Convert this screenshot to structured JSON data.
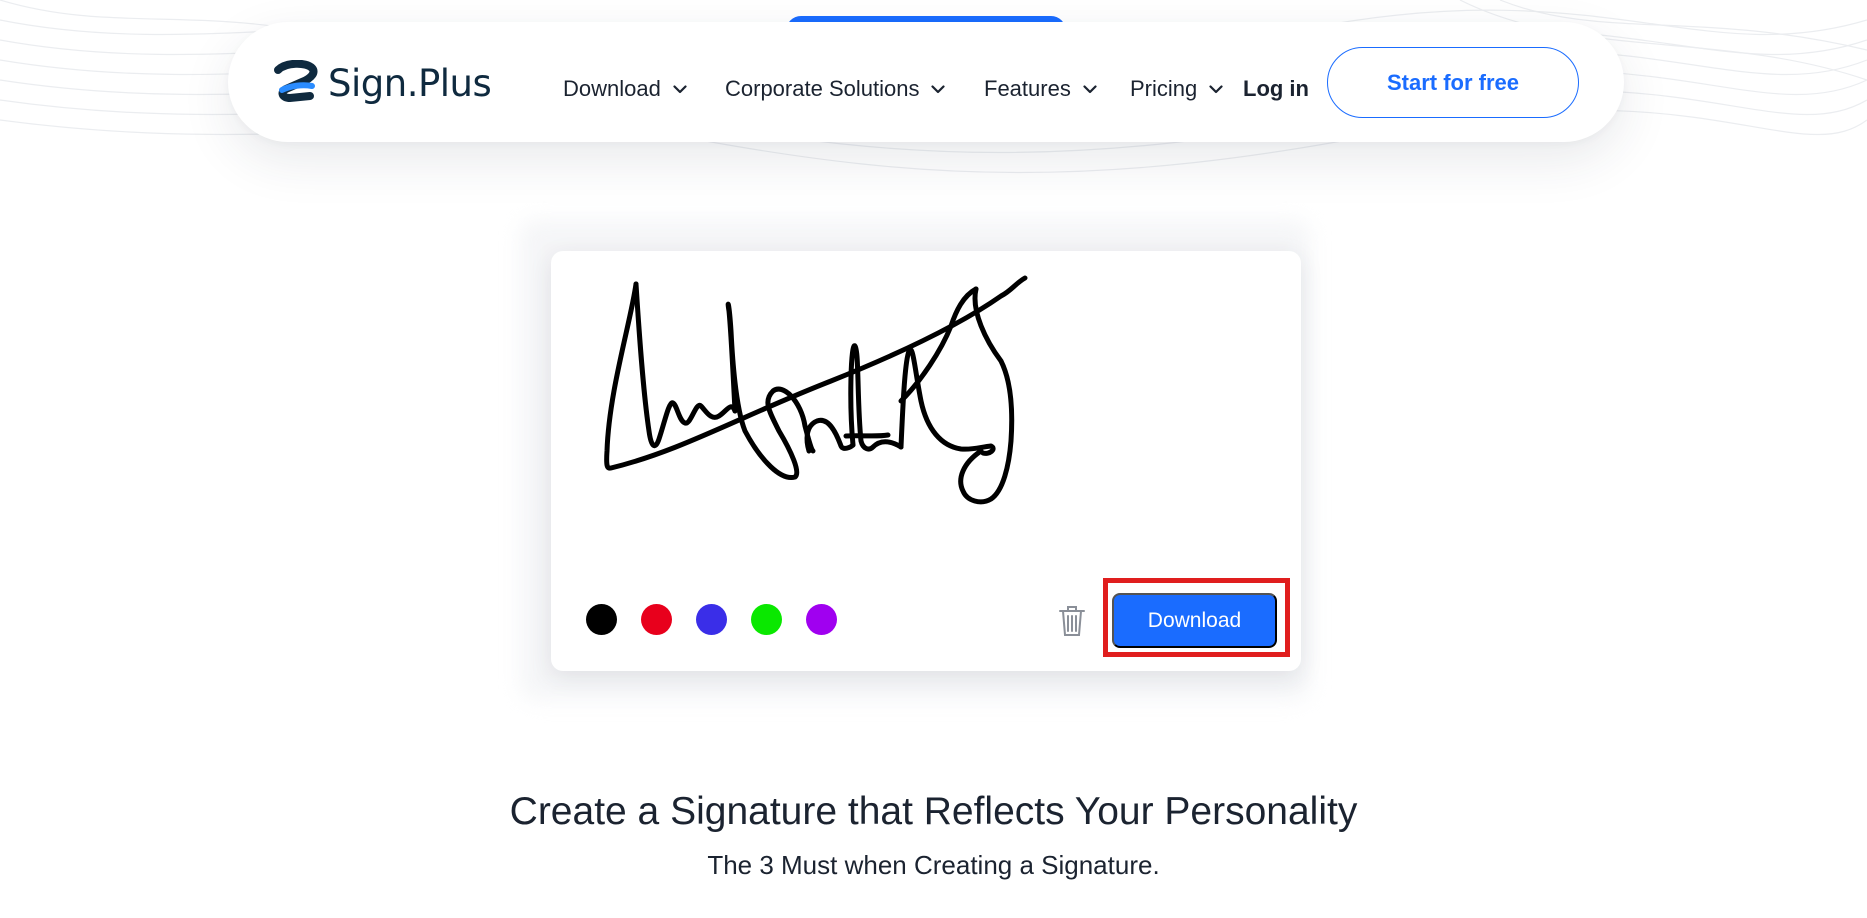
{
  "brand": {
    "name": "Sign.Plus"
  },
  "nav": {
    "items": [
      {
        "label": "Download",
        "icon": "chevron-down-icon"
      },
      {
        "label": "Corporate Solutions",
        "icon": "chevron-down-icon"
      },
      {
        "label": "Features",
        "icon": "chevron-down-icon"
      },
      {
        "label": "Pricing",
        "icon": "chevron-down-icon"
      }
    ],
    "login_label": "Log in",
    "cta_label": "Start for free"
  },
  "signature_pad": {
    "colors": [
      {
        "name": "black",
        "hex": "#000000"
      },
      {
        "name": "red",
        "hex": "#e8001c"
      },
      {
        "name": "blue",
        "hex": "#3a2ee8"
      },
      {
        "name": "green",
        "hex": "#0ae800"
      },
      {
        "name": "purple",
        "hex": "#a000f0"
      }
    ],
    "clear_icon": "trash-icon",
    "download_label": "Download",
    "accent": "#1a6cff",
    "highlight": "#e01e1e"
  },
  "section": {
    "title": "Create a Signature that Reflects Your Personality",
    "subtitle": "The 3 Must when Creating a Signature."
  }
}
